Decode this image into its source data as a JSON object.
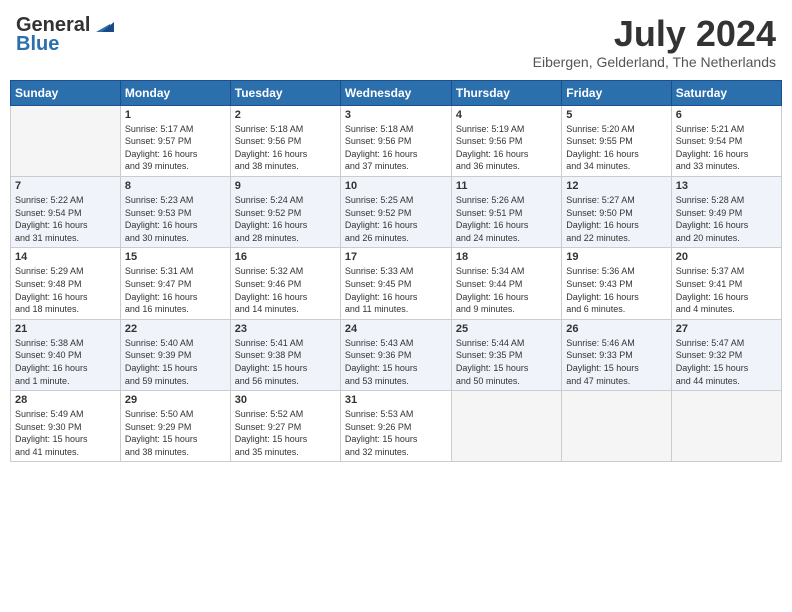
{
  "header": {
    "logo_general": "General",
    "logo_blue": "Blue",
    "title": "July 2024",
    "location": "Eibergen, Gelderland, The Netherlands"
  },
  "days_of_week": [
    "Sunday",
    "Monday",
    "Tuesday",
    "Wednesday",
    "Thursday",
    "Friday",
    "Saturday"
  ],
  "weeks": [
    [
      {
        "num": "",
        "info": ""
      },
      {
        "num": "1",
        "info": "Sunrise: 5:17 AM\nSunset: 9:57 PM\nDaylight: 16 hours\nand 39 minutes."
      },
      {
        "num": "2",
        "info": "Sunrise: 5:18 AM\nSunset: 9:56 PM\nDaylight: 16 hours\nand 38 minutes."
      },
      {
        "num": "3",
        "info": "Sunrise: 5:18 AM\nSunset: 9:56 PM\nDaylight: 16 hours\nand 37 minutes."
      },
      {
        "num": "4",
        "info": "Sunrise: 5:19 AM\nSunset: 9:56 PM\nDaylight: 16 hours\nand 36 minutes."
      },
      {
        "num": "5",
        "info": "Sunrise: 5:20 AM\nSunset: 9:55 PM\nDaylight: 16 hours\nand 34 minutes."
      },
      {
        "num": "6",
        "info": "Sunrise: 5:21 AM\nSunset: 9:54 PM\nDaylight: 16 hours\nand 33 minutes."
      }
    ],
    [
      {
        "num": "7",
        "info": "Sunrise: 5:22 AM\nSunset: 9:54 PM\nDaylight: 16 hours\nand 31 minutes."
      },
      {
        "num": "8",
        "info": "Sunrise: 5:23 AM\nSunset: 9:53 PM\nDaylight: 16 hours\nand 30 minutes."
      },
      {
        "num": "9",
        "info": "Sunrise: 5:24 AM\nSunset: 9:52 PM\nDaylight: 16 hours\nand 28 minutes."
      },
      {
        "num": "10",
        "info": "Sunrise: 5:25 AM\nSunset: 9:52 PM\nDaylight: 16 hours\nand 26 minutes."
      },
      {
        "num": "11",
        "info": "Sunrise: 5:26 AM\nSunset: 9:51 PM\nDaylight: 16 hours\nand 24 minutes."
      },
      {
        "num": "12",
        "info": "Sunrise: 5:27 AM\nSunset: 9:50 PM\nDaylight: 16 hours\nand 22 minutes."
      },
      {
        "num": "13",
        "info": "Sunrise: 5:28 AM\nSunset: 9:49 PM\nDaylight: 16 hours\nand 20 minutes."
      }
    ],
    [
      {
        "num": "14",
        "info": "Sunrise: 5:29 AM\nSunset: 9:48 PM\nDaylight: 16 hours\nand 18 minutes."
      },
      {
        "num": "15",
        "info": "Sunrise: 5:31 AM\nSunset: 9:47 PM\nDaylight: 16 hours\nand 16 minutes."
      },
      {
        "num": "16",
        "info": "Sunrise: 5:32 AM\nSunset: 9:46 PM\nDaylight: 16 hours\nand 14 minutes."
      },
      {
        "num": "17",
        "info": "Sunrise: 5:33 AM\nSunset: 9:45 PM\nDaylight: 16 hours\nand 11 minutes."
      },
      {
        "num": "18",
        "info": "Sunrise: 5:34 AM\nSunset: 9:44 PM\nDaylight: 16 hours\nand 9 minutes."
      },
      {
        "num": "19",
        "info": "Sunrise: 5:36 AM\nSunset: 9:43 PM\nDaylight: 16 hours\nand 6 minutes."
      },
      {
        "num": "20",
        "info": "Sunrise: 5:37 AM\nSunset: 9:41 PM\nDaylight: 16 hours\nand 4 minutes."
      }
    ],
    [
      {
        "num": "21",
        "info": "Sunrise: 5:38 AM\nSunset: 9:40 PM\nDaylight: 16 hours\nand 1 minute."
      },
      {
        "num": "22",
        "info": "Sunrise: 5:40 AM\nSunset: 9:39 PM\nDaylight: 15 hours\nand 59 minutes."
      },
      {
        "num": "23",
        "info": "Sunrise: 5:41 AM\nSunset: 9:38 PM\nDaylight: 15 hours\nand 56 minutes."
      },
      {
        "num": "24",
        "info": "Sunrise: 5:43 AM\nSunset: 9:36 PM\nDaylight: 15 hours\nand 53 minutes."
      },
      {
        "num": "25",
        "info": "Sunrise: 5:44 AM\nSunset: 9:35 PM\nDaylight: 15 hours\nand 50 minutes."
      },
      {
        "num": "26",
        "info": "Sunrise: 5:46 AM\nSunset: 9:33 PM\nDaylight: 15 hours\nand 47 minutes."
      },
      {
        "num": "27",
        "info": "Sunrise: 5:47 AM\nSunset: 9:32 PM\nDaylight: 15 hours\nand 44 minutes."
      }
    ],
    [
      {
        "num": "28",
        "info": "Sunrise: 5:49 AM\nSunset: 9:30 PM\nDaylight: 15 hours\nand 41 minutes."
      },
      {
        "num": "29",
        "info": "Sunrise: 5:50 AM\nSunset: 9:29 PM\nDaylight: 15 hours\nand 38 minutes."
      },
      {
        "num": "30",
        "info": "Sunrise: 5:52 AM\nSunset: 9:27 PM\nDaylight: 15 hours\nand 35 minutes."
      },
      {
        "num": "31",
        "info": "Sunrise: 5:53 AM\nSunset: 9:26 PM\nDaylight: 15 hours\nand 32 minutes."
      },
      {
        "num": "",
        "info": ""
      },
      {
        "num": "",
        "info": ""
      },
      {
        "num": "",
        "info": ""
      }
    ]
  ]
}
